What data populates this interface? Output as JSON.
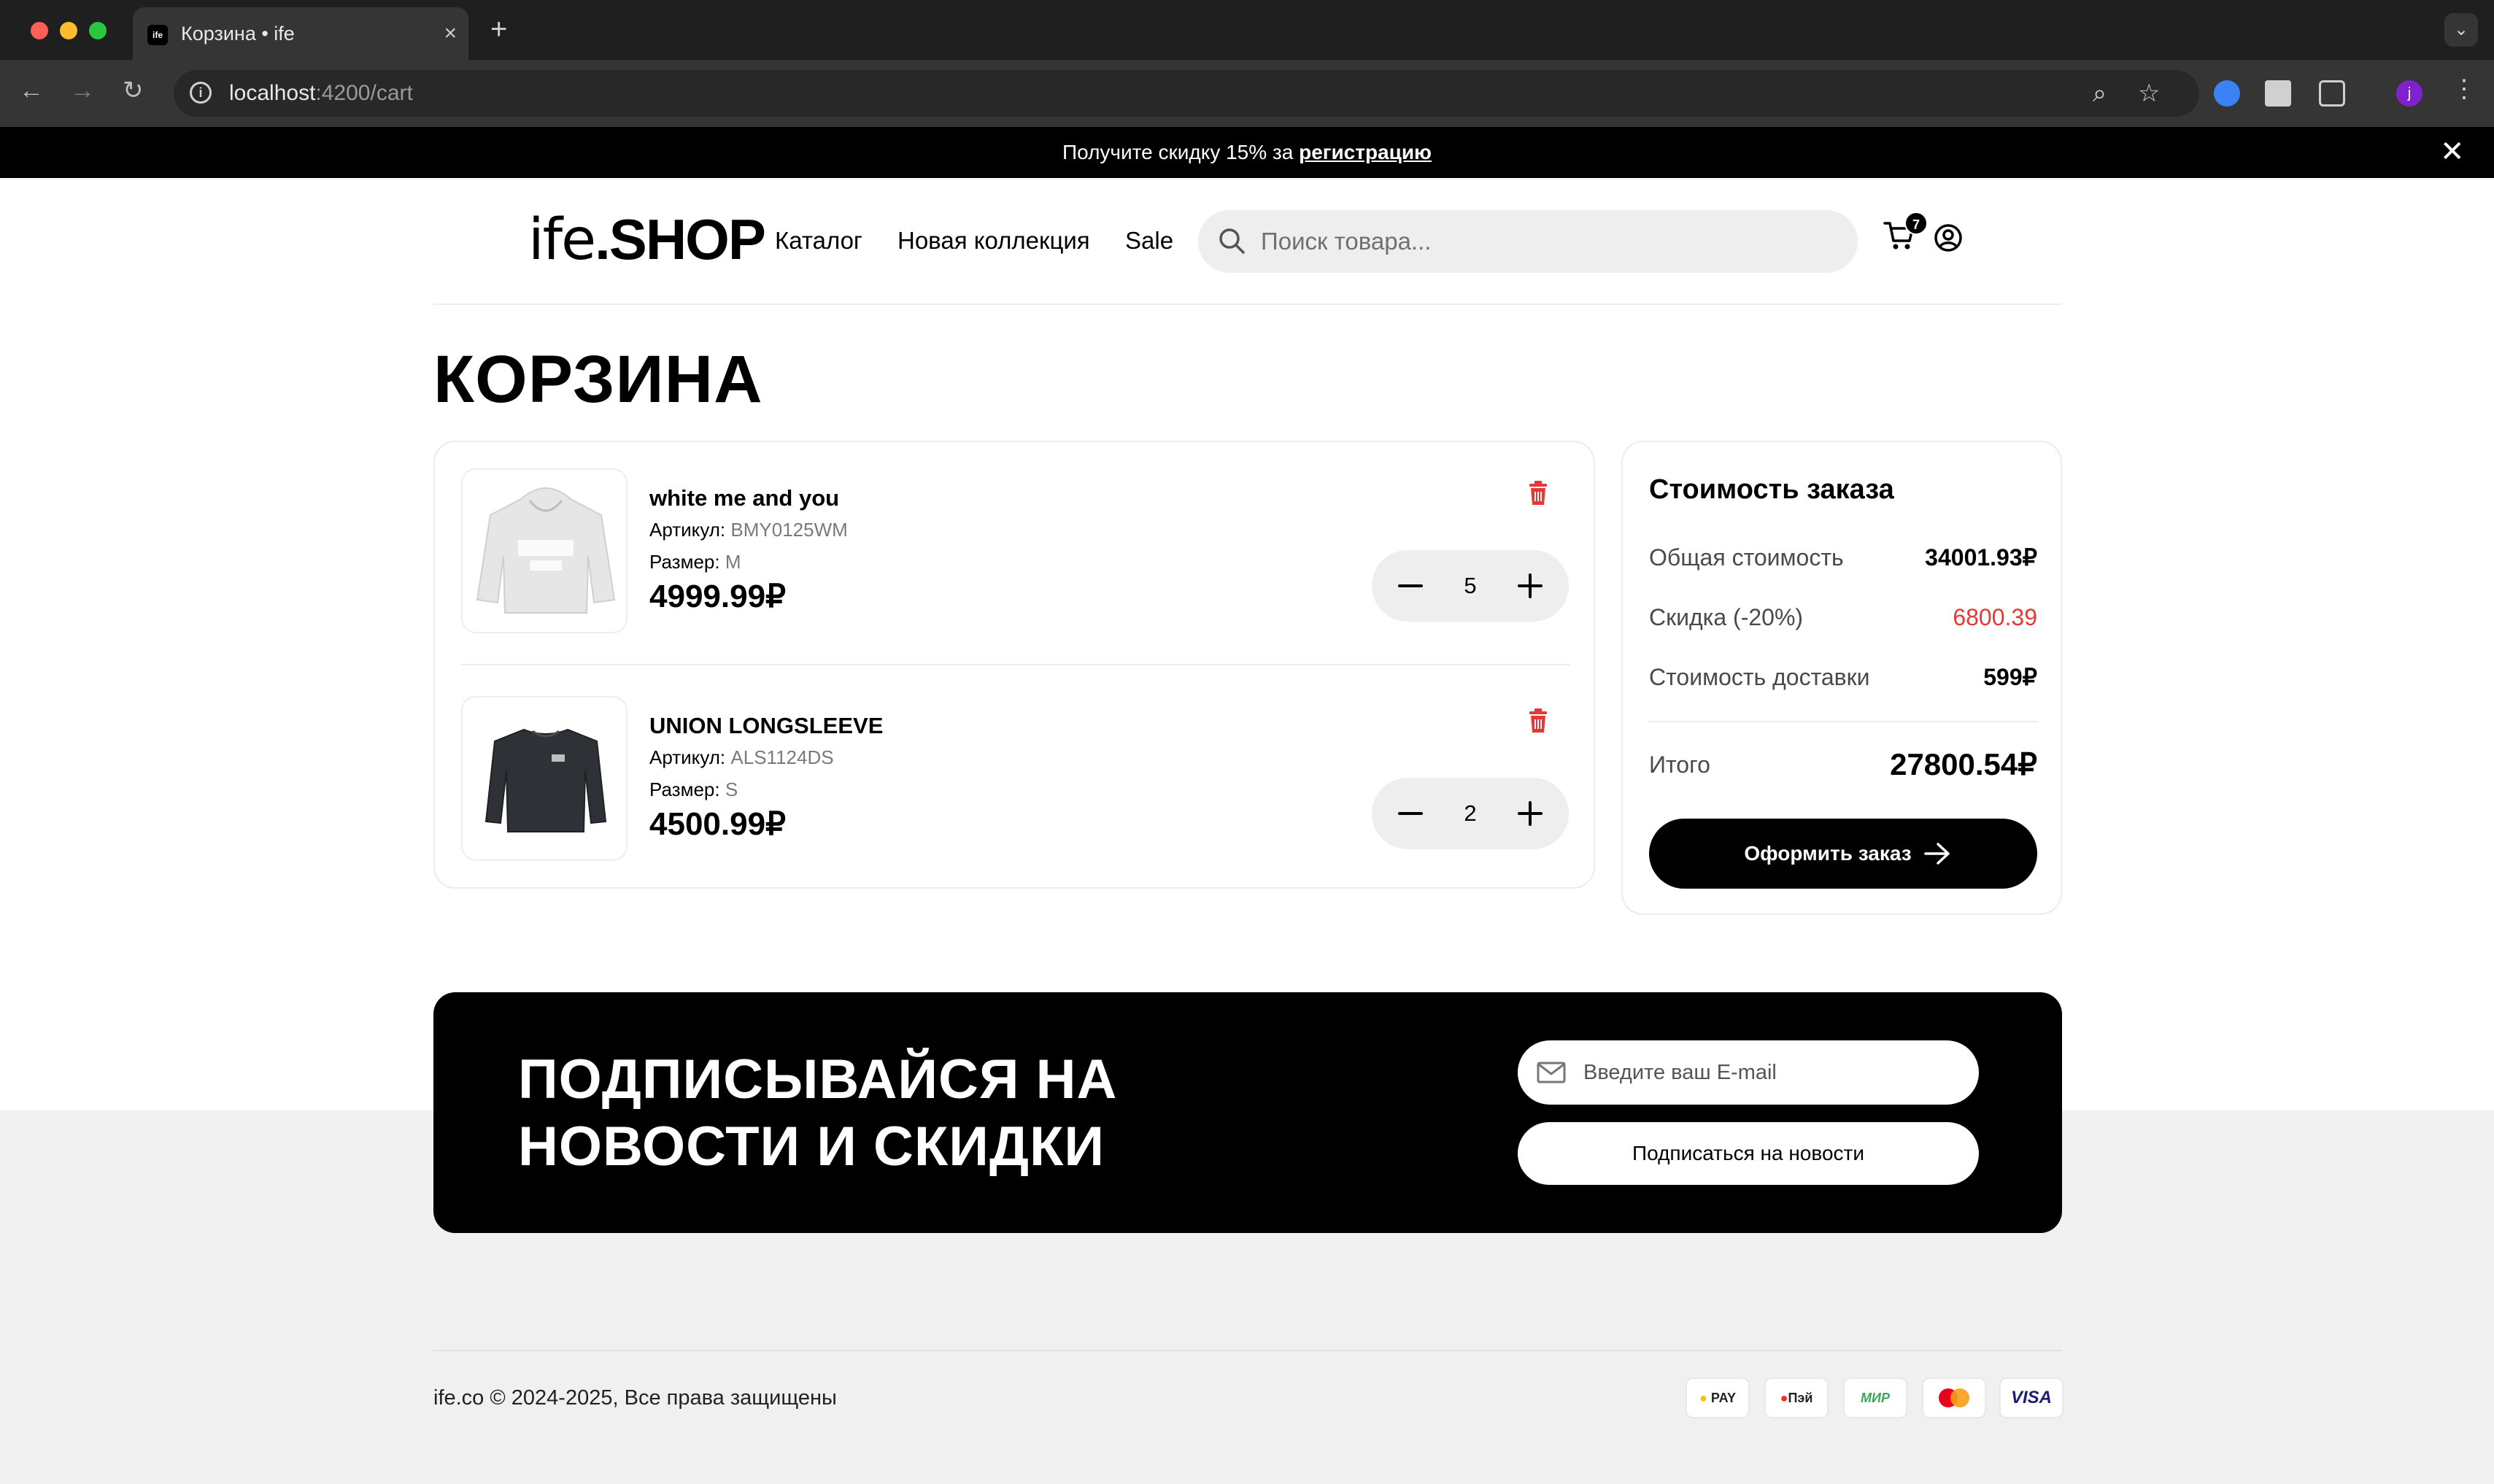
{
  "browser": {
    "tab_title": "Корзина • ife",
    "tab_favicon": "ife",
    "url_host": "localhost",
    "url_path": ":4200/cart",
    "profile_initial": "j"
  },
  "promo": {
    "text": "Получите скидку 15% за ",
    "link": "регистрацию"
  },
  "header": {
    "logo_thin": "ife",
    "logo_bold": ".SHOP",
    "nav": [
      "Каталог",
      "Новая коллекция",
      "Sale"
    ],
    "search_placeholder": "Поиск товара...",
    "cart_count": "7"
  },
  "cart": {
    "title": "КОРЗИНА",
    "article_label": "Артикул: ",
    "size_label": "Размер: ",
    "items": [
      {
        "name": "white me and you",
        "article": "BMY0125WM",
        "size": "M",
        "price": "4999.99₽",
        "qty": "5"
      },
      {
        "name": "UNION LONGSLEEVE",
        "article": "ALS1124DS",
        "size": "S",
        "price": "4500.99₽",
        "qty": "2"
      }
    ]
  },
  "summary": {
    "title": "Стоимость заказа",
    "total_cost_label": "Общая стоимость",
    "total_cost_value": "34001.93₽",
    "discount_label": "Скидка (-20%)",
    "discount_value": "6800.39",
    "delivery_label": "Стоимость доставки",
    "delivery_value": "599₽",
    "itogo_label": "Итого",
    "itogo_value": "27800.54₽",
    "checkout_label": "Оформить заказ"
  },
  "newsletter": {
    "title_line1": "ПОДПИСЫВАЙСЯ НА",
    "title_line2": "НОВОСТИ И СКИДКИ",
    "email_placeholder": "Введите ваш E-mail",
    "subscribe_label": "Подписаться на новости"
  },
  "footer": {
    "copyright": "ife.co © 2024-2025, Все права защищены",
    "payments": [
      "PAY",
      "Пэй",
      "МИР",
      "",
      "VISA"
    ]
  },
  "colors": {
    "accent": "#000000",
    "discount": "#e53935",
    "trash": "#e53935",
    "surface": "#eeeeee"
  }
}
